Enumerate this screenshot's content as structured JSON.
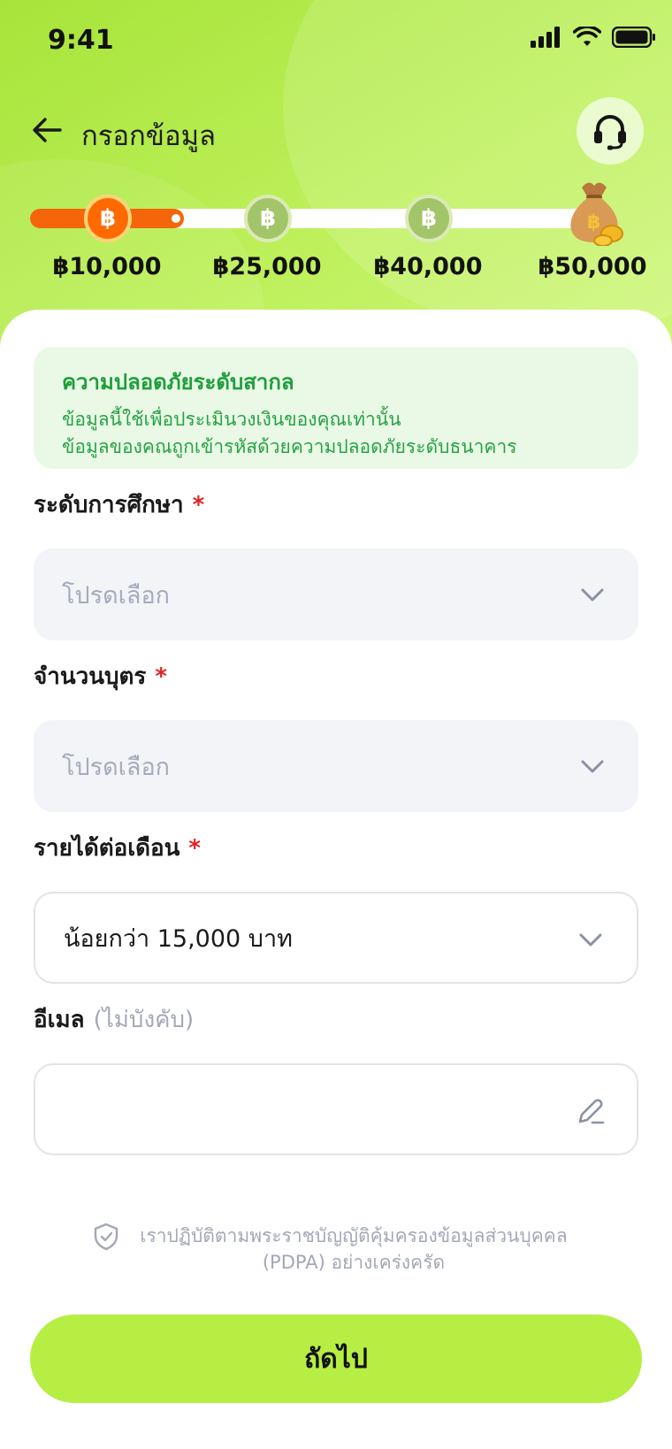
{
  "status_bar": {
    "time": "9:41"
  },
  "header": {
    "title": "กรอกข้อมูล"
  },
  "progress": {
    "current_step": 1,
    "milestones": [
      "฿10,000",
      "฿25,000",
      "฿40,000",
      "฿50,000"
    ],
    "coin_symbol": "฿"
  },
  "notice": {
    "title": "ความปลอดภัยระดับสากล",
    "line1": "ข้อมูลนี้ใช้เพื่อประเมินวงเงินของคุณเท่านั้น",
    "line2": "ข้อมูลของคณถูกเข้ารหัสด้วยความปลอดภัยระดับธนาคาร"
  },
  "form": {
    "education": {
      "label": "ระดับการศึกษา",
      "required_mark": "*",
      "value": "โปรดเลือก"
    },
    "children": {
      "label": "จำนวนบุตร",
      "required_mark": "*",
      "value": "โปรดเลือก"
    },
    "income": {
      "label": "รายได้ต่อเดือน",
      "required_mark": "*",
      "value": "น้อยกว่า 15,000 บาท"
    },
    "email": {
      "label": "อีเมล",
      "optional_note": "(ไม่บังคับ)",
      "value": ""
    }
  },
  "pdpa": {
    "text": "เราปฏิบัติตามพระราชบัญญัติคุ้มครองข้อมูลส่วนบุคคล (PDPA) อย่างเคร่งครัด"
  },
  "next_button": {
    "label": "ถัดไป"
  },
  "colors": {
    "accent_green": "#b6ee43",
    "active_orange": "#f5650a",
    "notice_green": "#1f9e3c",
    "required_red": "#e02424"
  }
}
